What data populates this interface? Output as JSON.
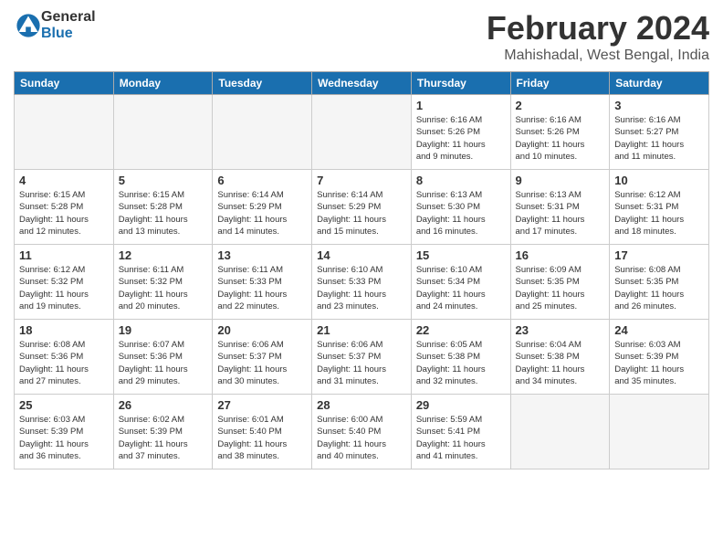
{
  "logo": {
    "general": "General",
    "blue": "Blue"
  },
  "title": "February 2024",
  "location": "Mahishadal, West Bengal, India",
  "headers": [
    "Sunday",
    "Monday",
    "Tuesday",
    "Wednesday",
    "Thursday",
    "Friday",
    "Saturday"
  ],
  "weeks": [
    [
      {
        "day": "",
        "info": "",
        "empty": true
      },
      {
        "day": "",
        "info": "",
        "empty": true
      },
      {
        "day": "",
        "info": "",
        "empty": true
      },
      {
        "day": "",
        "info": "",
        "empty": true
      },
      {
        "day": "1",
        "info": "Sunrise: 6:16 AM\nSunset: 5:26 PM\nDaylight: 11 hours\nand 9 minutes."
      },
      {
        "day": "2",
        "info": "Sunrise: 6:16 AM\nSunset: 5:26 PM\nDaylight: 11 hours\nand 10 minutes."
      },
      {
        "day": "3",
        "info": "Sunrise: 6:16 AM\nSunset: 5:27 PM\nDaylight: 11 hours\nand 11 minutes."
      }
    ],
    [
      {
        "day": "4",
        "info": "Sunrise: 6:15 AM\nSunset: 5:28 PM\nDaylight: 11 hours\nand 12 minutes."
      },
      {
        "day": "5",
        "info": "Sunrise: 6:15 AM\nSunset: 5:28 PM\nDaylight: 11 hours\nand 13 minutes."
      },
      {
        "day": "6",
        "info": "Sunrise: 6:14 AM\nSunset: 5:29 PM\nDaylight: 11 hours\nand 14 minutes."
      },
      {
        "day": "7",
        "info": "Sunrise: 6:14 AM\nSunset: 5:29 PM\nDaylight: 11 hours\nand 15 minutes."
      },
      {
        "day": "8",
        "info": "Sunrise: 6:13 AM\nSunset: 5:30 PM\nDaylight: 11 hours\nand 16 minutes."
      },
      {
        "day": "9",
        "info": "Sunrise: 6:13 AM\nSunset: 5:31 PM\nDaylight: 11 hours\nand 17 minutes."
      },
      {
        "day": "10",
        "info": "Sunrise: 6:12 AM\nSunset: 5:31 PM\nDaylight: 11 hours\nand 18 minutes."
      }
    ],
    [
      {
        "day": "11",
        "info": "Sunrise: 6:12 AM\nSunset: 5:32 PM\nDaylight: 11 hours\nand 19 minutes."
      },
      {
        "day": "12",
        "info": "Sunrise: 6:11 AM\nSunset: 5:32 PM\nDaylight: 11 hours\nand 20 minutes."
      },
      {
        "day": "13",
        "info": "Sunrise: 6:11 AM\nSunset: 5:33 PM\nDaylight: 11 hours\nand 22 minutes."
      },
      {
        "day": "14",
        "info": "Sunrise: 6:10 AM\nSunset: 5:33 PM\nDaylight: 11 hours\nand 23 minutes."
      },
      {
        "day": "15",
        "info": "Sunrise: 6:10 AM\nSunset: 5:34 PM\nDaylight: 11 hours\nand 24 minutes."
      },
      {
        "day": "16",
        "info": "Sunrise: 6:09 AM\nSunset: 5:35 PM\nDaylight: 11 hours\nand 25 minutes."
      },
      {
        "day": "17",
        "info": "Sunrise: 6:08 AM\nSunset: 5:35 PM\nDaylight: 11 hours\nand 26 minutes."
      }
    ],
    [
      {
        "day": "18",
        "info": "Sunrise: 6:08 AM\nSunset: 5:36 PM\nDaylight: 11 hours\nand 27 minutes."
      },
      {
        "day": "19",
        "info": "Sunrise: 6:07 AM\nSunset: 5:36 PM\nDaylight: 11 hours\nand 29 minutes."
      },
      {
        "day": "20",
        "info": "Sunrise: 6:06 AM\nSunset: 5:37 PM\nDaylight: 11 hours\nand 30 minutes."
      },
      {
        "day": "21",
        "info": "Sunrise: 6:06 AM\nSunset: 5:37 PM\nDaylight: 11 hours\nand 31 minutes."
      },
      {
        "day": "22",
        "info": "Sunrise: 6:05 AM\nSunset: 5:38 PM\nDaylight: 11 hours\nand 32 minutes."
      },
      {
        "day": "23",
        "info": "Sunrise: 6:04 AM\nSunset: 5:38 PM\nDaylight: 11 hours\nand 34 minutes."
      },
      {
        "day": "24",
        "info": "Sunrise: 6:03 AM\nSunset: 5:39 PM\nDaylight: 11 hours\nand 35 minutes."
      }
    ],
    [
      {
        "day": "25",
        "info": "Sunrise: 6:03 AM\nSunset: 5:39 PM\nDaylight: 11 hours\nand 36 minutes."
      },
      {
        "day": "26",
        "info": "Sunrise: 6:02 AM\nSunset: 5:39 PM\nDaylight: 11 hours\nand 37 minutes."
      },
      {
        "day": "27",
        "info": "Sunrise: 6:01 AM\nSunset: 5:40 PM\nDaylight: 11 hours\nand 38 minutes."
      },
      {
        "day": "28",
        "info": "Sunrise: 6:00 AM\nSunset: 5:40 PM\nDaylight: 11 hours\nand 40 minutes."
      },
      {
        "day": "29",
        "info": "Sunrise: 5:59 AM\nSunset: 5:41 PM\nDaylight: 11 hours\nand 41 minutes."
      },
      {
        "day": "",
        "info": "",
        "empty": true
      },
      {
        "day": "",
        "info": "",
        "empty": true
      }
    ]
  ]
}
